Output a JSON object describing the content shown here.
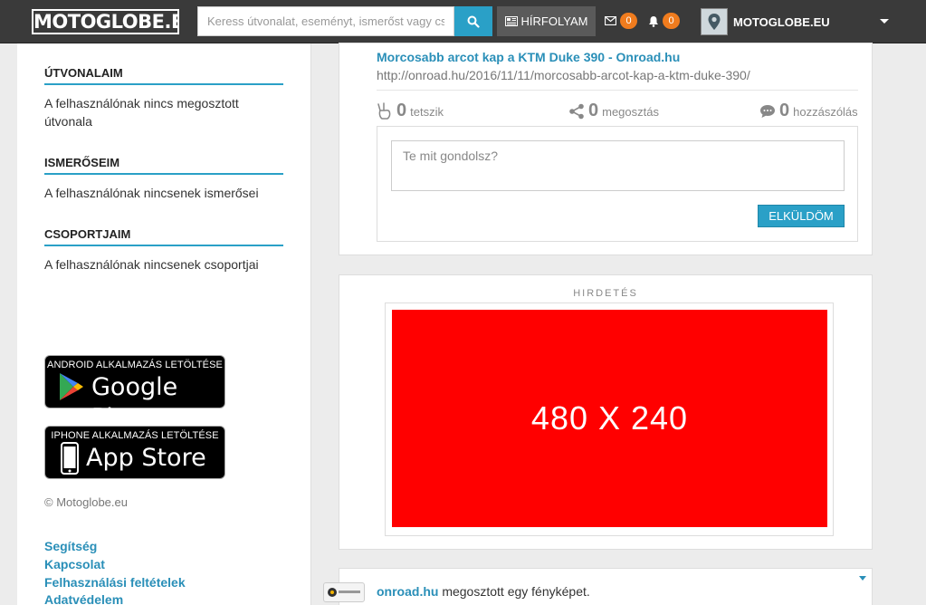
{
  "navbar": {
    "logo": "MOTOGLOBE.EU",
    "search_placeholder": "Keress útvonalat, eseményt, ismerőst vagy csoportot",
    "feed_label": "HÍRFOLYAM",
    "messages_count": "0",
    "notifications_count": "0",
    "user_name": "MOTOGLOBE.EU"
  },
  "sidebar": {
    "sections": [
      {
        "title": "ÚTVONALAIM",
        "text": "A felhasználónak nincs megosztott útvonala"
      },
      {
        "title": "ISMERŐSEIM",
        "text": "A felhasználónak nincsenek ismerősei"
      },
      {
        "title": "CSOPORTJAIM",
        "text": "A felhasználónak nincsenek csoportjai"
      }
    ],
    "android_small": "ANDROID ALKALMAZÁS LETÖLTÉSE",
    "android_big": "Google Play",
    "iphone_small": "IPHONE ALKALMAZÁS LETÖLTÉSE",
    "iphone_big": "App Store",
    "copyright": "© Motoglobe.eu",
    "links": [
      "Segítség",
      "Kapcsolat",
      "Felhasználási feltételek",
      "Adatvédelem"
    ]
  },
  "shared_post": {
    "title": "Morcosabb arcot kap a KTM Duke 390 - Onroad.hu",
    "url": "http://onroad.hu/2016/11/11/morcosabb-arcot-kap-a-ktm-duke-390/",
    "likes_count": "0",
    "likes_label": "tetszik",
    "shares_count": "0",
    "shares_label": "megosztás",
    "comments_count": "0",
    "comments_label": "hozzászólás",
    "comment_placeholder": "Te mit gondolsz?",
    "send_label": "ELKÜLDÖM"
  },
  "ad": {
    "label": "HIRDETÉS",
    "size_text": "480 X 240",
    "color": "#ff0000"
  },
  "next_post": {
    "author": "onroad.hu",
    "action": " megosztott egy fényképet."
  },
  "colors": {
    "accent": "#2aa0c7",
    "navbar": "#3a3a3a",
    "badge": "#f07c1e"
  }
}
